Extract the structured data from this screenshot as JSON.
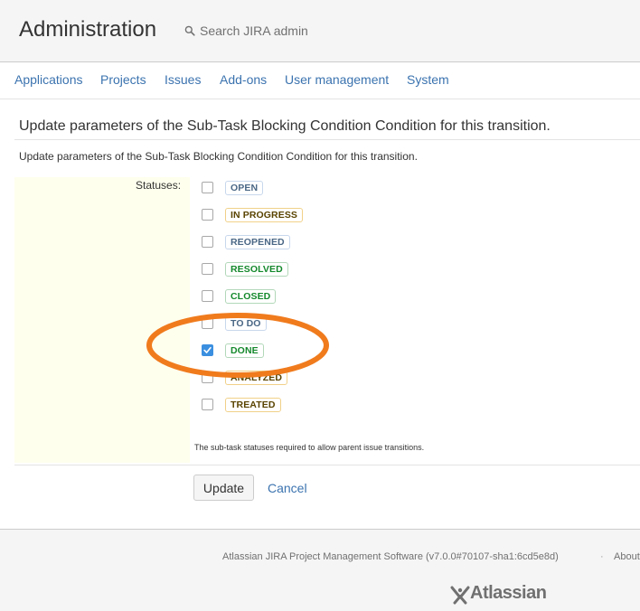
{
  "header": {
    "title": "Administration",
    "search_placeholder": "Search JIRA admin"
  },
  "nav": {
    "items": [
      "Applications",
      "Projects",
      "Issues",
      "Add-ons",
      "User management",
      "System"
    ]
  },
  "page": {
    "heading": "Update parameters of the Sub-Task Blocking Condition Condition for this transition.",
    "description": "Update parameters of the Sub-Task Blocking Condition Condition for this transition."
  },
  "form": {
    "statuses_label": "Statuses:",
    "statuses": [
      {
        "name": "OPEN",
        "color": "#4a6785",
        "checked": false
      },
      {
        "name": "IN PROGRESS",
        "color": "#594300",
        "checked": false
      },
      {
        "name": "REOPENED",
        "color": "#4a6785",
        "checked": false
      },
      {
        "name": "RESOLVED",
        "color": "#14892c",
        "checked": false
      },
      {
        "name": "CLOSED",
        "color": "#14892c",
        "checked": false
      },
      {
        "name": "TO DO",
        "color": "#4a6785",
        "checked": false
      },
      {
        "name": "DONE",
        "color": "#14892c",
        "checked": true
      },
      {
        "name": "ANALYZED",
        "color": "#594300",
        "checked": false
      },
      {
        "name": "TREATED",
        "color": "#594300",
        "checked": false
      }
    ],
    "field_description": "The sub-task statuses required to allow parent issue transitions.",
    "update_label": "Update",
    "cancel_label": "Cancel"
  },
  "footer": {
    "software_text": "Atlassian JIRA Project Management Software (v7.0.0#70107-sha1:6cd5e8d)",
    "separator": "·",
    "about_text": "About",
    "logo_text": "Atlassian"
  },
  "annotation": {
    "color": "#f07b1d",
    "shape": "ellipse"
  }
}
